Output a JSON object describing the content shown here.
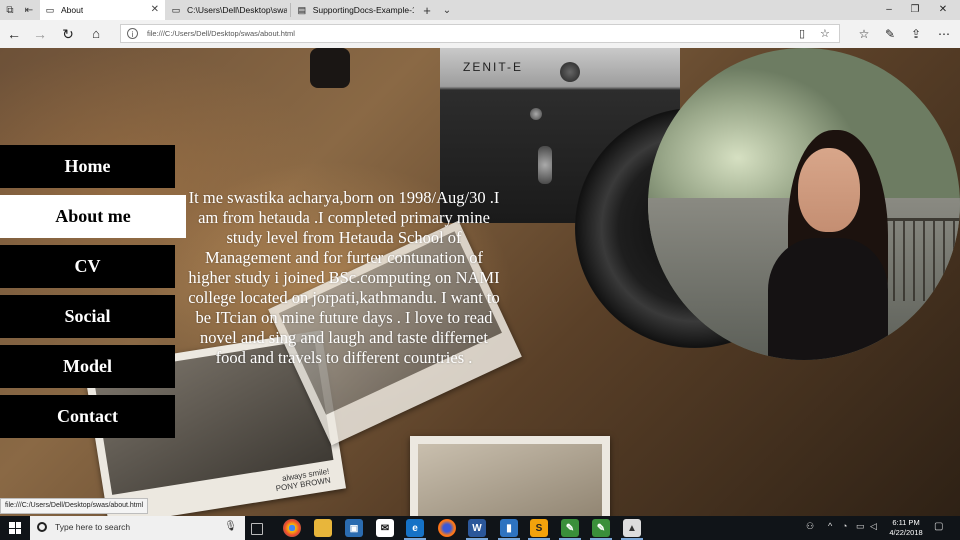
{
  "browser": {
    "tabs": [
      {
        "title": "About",
        "active": true
      },
      {
        "title": "C:\\Users\\Dell\\Desktop\\swas",
        "active": false
      },
      {
        "title": "SupportingDocs-Example-1",
        "active": false
      }
    ],
    "address_url": "file:///C:/Users/Dell/Desktop/swas/about.html",
    "status_url": "file:///C:/Users/Dell/Desktop/swas/about.html"
  },
  "page": {
    "camera_brand": "ZENIT-E",
    "menu": [
      {
        "label": "Home",
        "active": false
      },
      {
        "label": "About me",
        "active": true
      },
      {
        "label": "CV",
        "active": false
      },
      {
        "label": "Social",
        "active": false
      },
      {
        "label": "Model",
        "active": false
      },
      {
        "label": "Contact",
        "active": false
      }
    ],
    "about_text": "It me swastika acharya,born on 1998/Aug/30 .I am from hetauda .I completed primary mine study level from Hetauda School of Management and for furter contunation of higher study i joined BSc.computing on NAMI college located on jorpati,kathmandu. I want to be ITcian on mine future days . I love to read novel and sing and laugh and taste differnet food and travels to different countries .",
    "photo_caption": "always smile!\nPONY BROWN"
  },
  "taskbar": {
    "search_placeholder": "Type here to search",
    "time": "6:11 PM",
    "date": "4/22/2018"
  }
}
